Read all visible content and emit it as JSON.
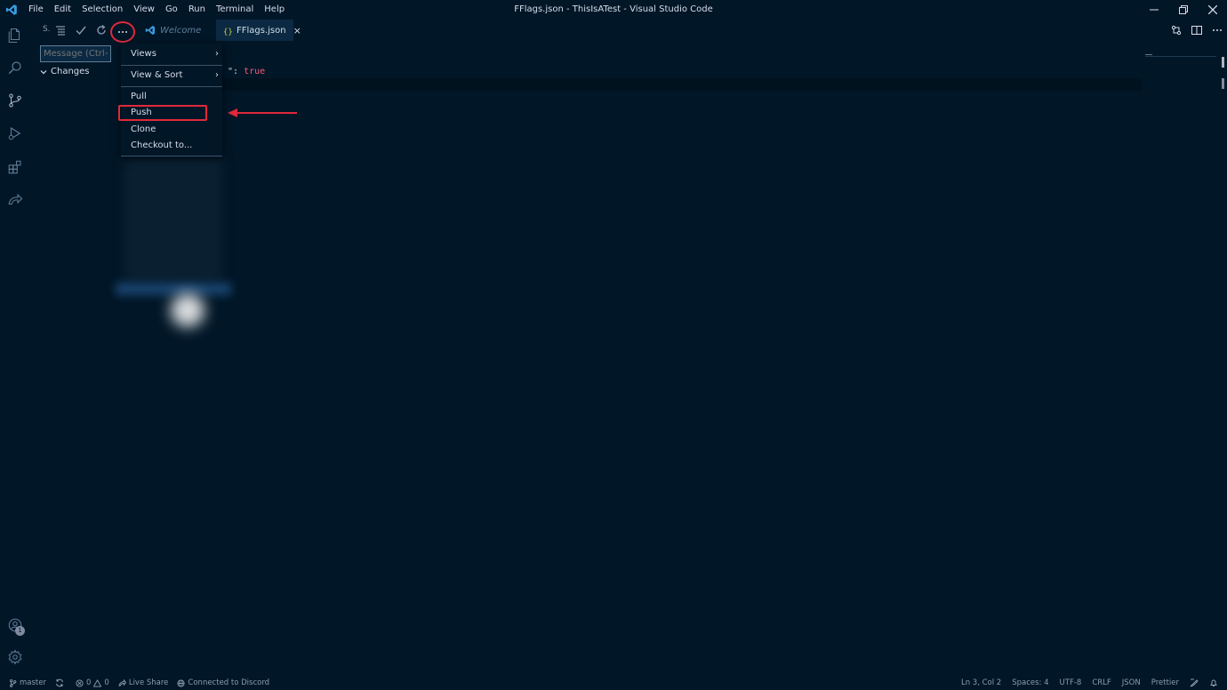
{
  "titlebar": {
    "menu": [
      "File",
      "Edit",
      "Selection",
      "View",
      "Go",
      "Run",
      "Terminal",
      "Help"
    ],
    "title": "FFlags.json - ThisIsATest - Visual Studio Code"
  },
  "sidebar": {
    "title_short": "S.",
    "message_placeholder": "Message (Ctrl+Enter",
    "changes_label": "Changes"
  },
  "tabs": [
    {
      "label": "Welcome",
      "active": false
    },
    {
      "label": "FFlags.json",
      "active": true,
      "close": "×"
    }
  ],
  "editor": {
    "code_punc": "\": ",
    "code_value": "true"
  },
  "context_menu": {
    "items": [
      {
        "label": "Views",
        "submenu": true
      },
      {
        "label": "View & Sort",
        "submenu": true
      },
      {
        "label": "Pull"
      },
      {
        "label": "Push",
        "highlighted": true
      },
      {
        "label": "Clone"
      },
      {
        "label": "Checkout to..."
      }
    ],
    "submenu_arrow": "›"
  },
  "activity": {
    "account_badge": "1"
  },
  "statusbar": {
    "branch": "master",
    "errors": "0",
    "warnings": "0",
    "live_share": "Live Share",
    "discord": "Connected to Discord",
    "cursor": "Ln 3, Col 2",
    "spaces": "Spaces: 4",
    "encoding": "UTF-8",
    "eol": "CRLF",
    "language": "JSON",
    "formatter": "Prettier"
  },
  "colors": {
    "background": "#011627",
    "highlight_red": "#e0293a",
    "keyword": "#ff5874"
  }
}
